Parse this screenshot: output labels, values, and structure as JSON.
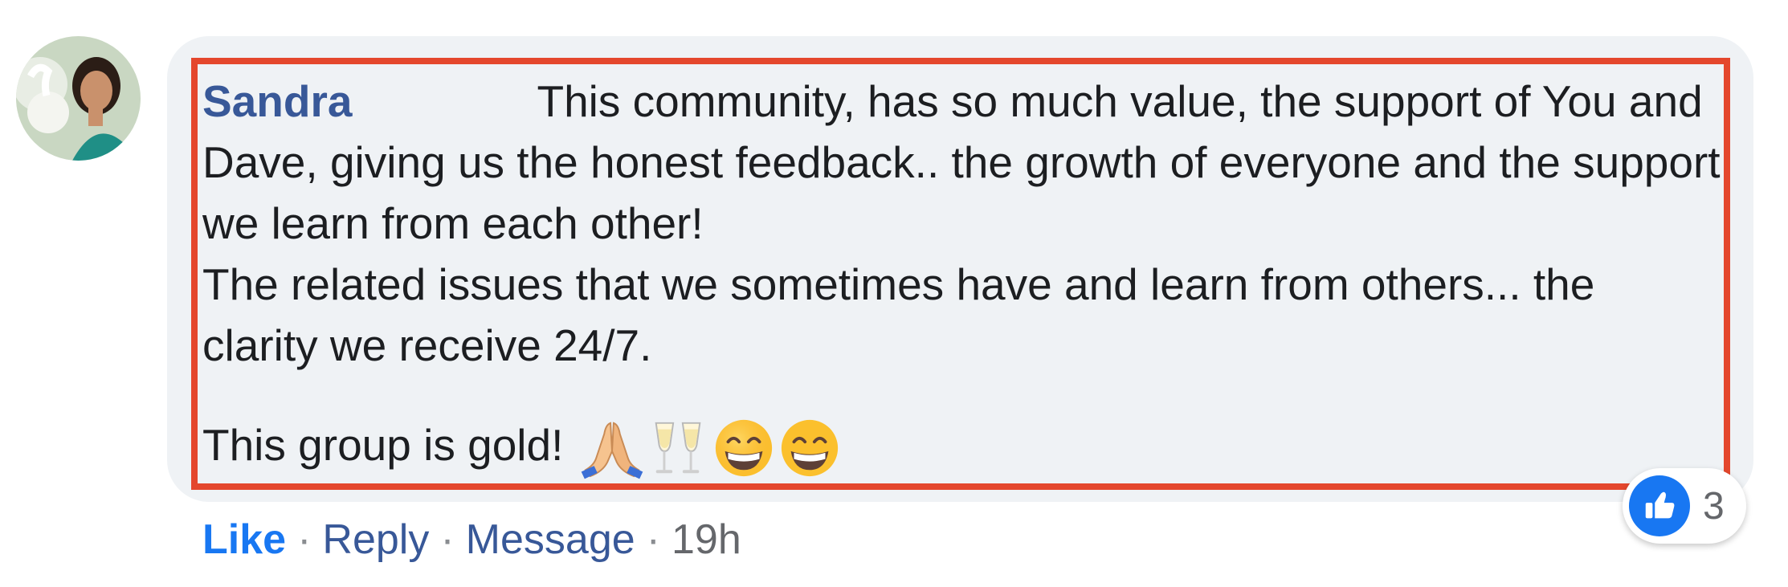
{
  "comment": {
    "author": "Sandra",
    "lines": [
      "This community, has so much value, the support of You and Dave, giving us the honest feedback.. the growth of everyone and the support we learn from each other!",
      "The related issues that we sometimes have and learn from others... the clarity we receive 24/7.",
      "This group is gold!"
    ],
    "emojis": [
      "folded-hands",
      "clinking-glasses",
      "grinning-face",
      "grinning-face"
    ]
  },
  "actions": {
    "like": "Like",
    "reply": "Reply",
    "message": "Message",
    "time": "19h",
    "separator": "·"
  },
  "reactions": {
    "icon": "thumbs-up-icon",
    "count": "3"
  },
  "colors": {
    "author": "#385898",
    "like": "#1877f2",
    "bubble": "#eff2f5",
    "highlight": "#e4472d"
  }
}
